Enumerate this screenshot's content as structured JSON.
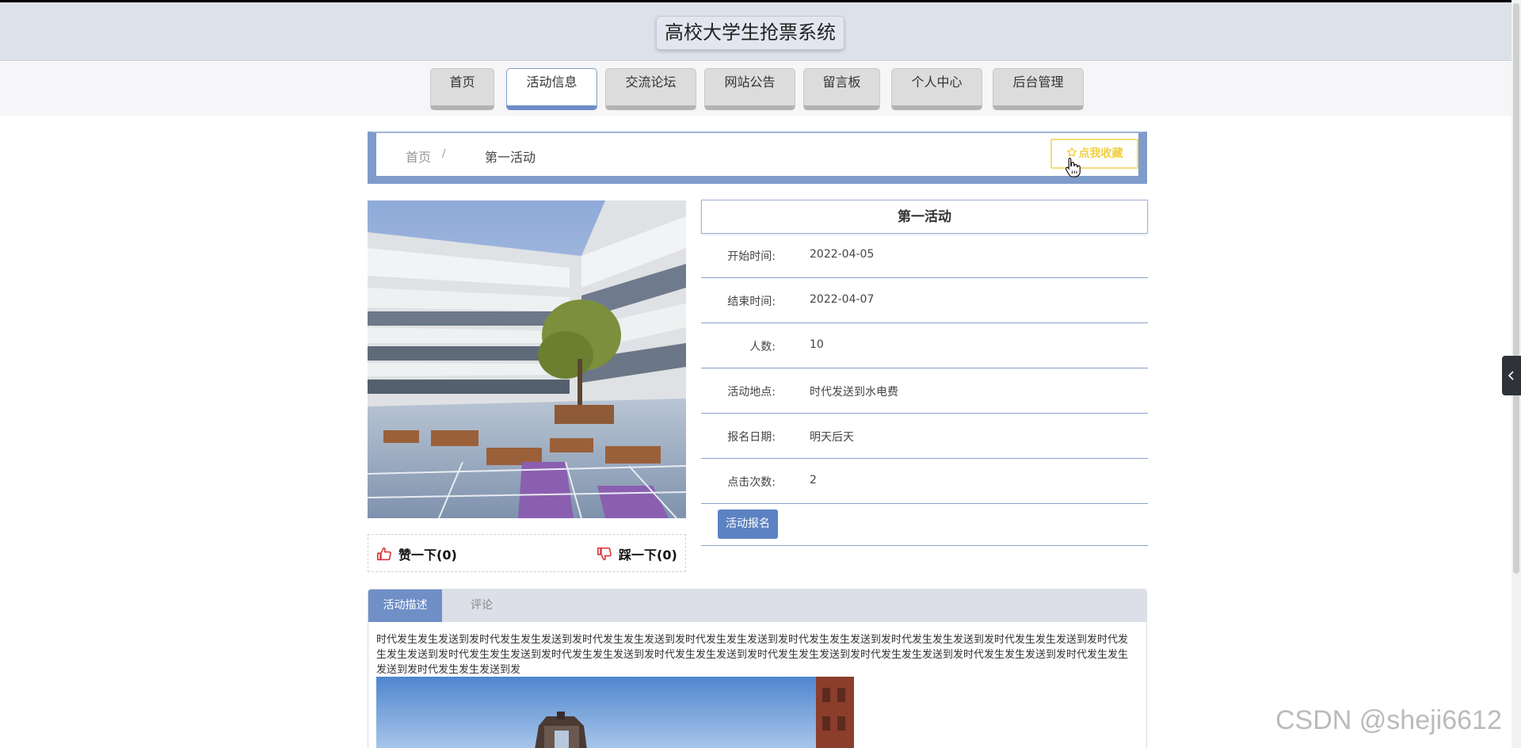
{
  "header": {
    "title": "高校大学生抢票系统"
  },
  "nav": {
    "items": [
      {
        "label": "首页"
      },
      {
        "label": "活动信息"
      },
      {
        "label": "交流论坛"
      },
      {
        "label": "网站公告"
      },
      {
        "label": "留言板"
      },
      {
        "label": "个人中心"
      },
      {
        "label": "后台管理"
      }
    ],
    "active_index": 1
  },
  "breadcrumb": {
    "home": "首页",
    "separator": "/",
    "current": "第一活动"
  },
  "favorite": {
    "label": "点我收藏",
    "icon": "star-outline-icon"
  },
  "reactions": {
    "like": {
      "label": "赞一下(0)",
      "icon": "thumbs-up-icon"
    },
    "dislike": {
      "label": "踩一下(0)",
      "icon": "thumbs-down-icon"
    }
  },
  "activity": {
    "title": "第一活动",
    "fields": [
      {
        "label": "开始时间:",
        "value": "2022-04-05"
      },
      {
        "label": "结束时间:",
        "value": "2022-04-07"
      },
      {
        "label": "人数:",
        "value": "10"
      },
      {
        "label": "活动地点:",
        "value": "时代发送到水电费"
      },
      {
        "label": "报名日期:",
        "value": "明天后天"
      },
      {
        "label": "点击次数:",
        "value": "2"
      }
    ],
    "signup_label": "活动报名"
  },
  "tabs": {
    "items": [
      {
        "label": "活动描述"
      },
      {
        "label": "评论"
      }
    ],
    "active_index": 0,
    "description": "时代发生发生发送到发时代发生发生发送到发时代发生发生发送到发时代发生发生发送到发时代发生发生发送到发时代发生发生发送到发时代发生发生发送到发时代发生发生发送到发时代发生发生发送到发时代发生发生发送到发时代发生发生发送到发时代发生发生发送到发时代发生发生发送到发时代发生发生发送到发时代发生发生发送到发时代发生发生发送到发"
  },
  "side_toggle": {
    "icon": "chevron-left-icon"
  },
  "watermark": "CSDN @sheji6612",
  "colors": {
    "header_bg": "#dde1ea",
    "accent": "#7f9bc9",
    "button_blue": "#5d82c3",
    "favorite_yellow": "#f1cf3e",
    "like_red": "#d9383a"
  }
}
